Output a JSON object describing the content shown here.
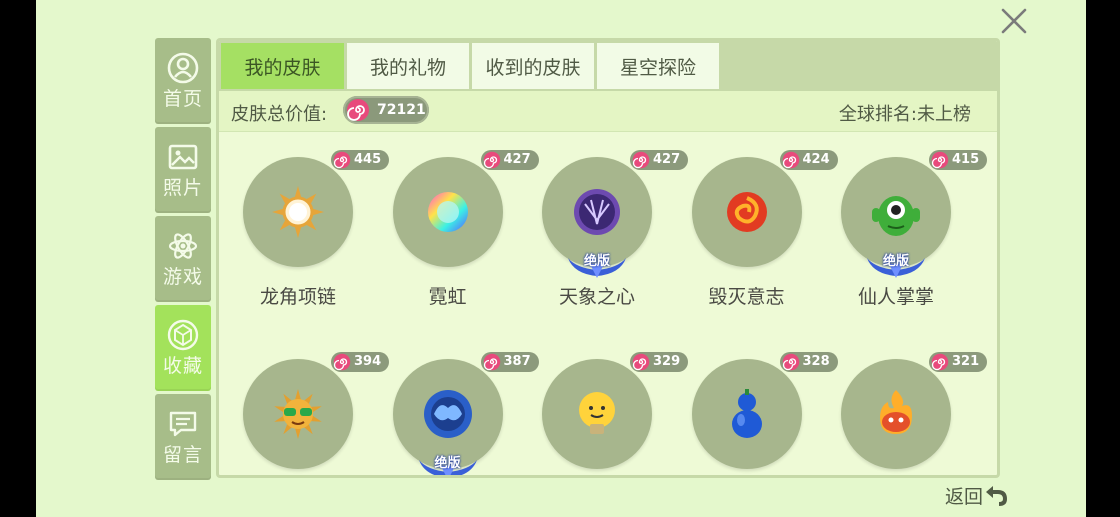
{
  "nav": [
    {
      "label": "首页",
      "icon": "profile-icon"
    },
    {
      "label": "照片",
      "icon": "photo-icon"
    },
    {
      "label": "游戏",
      "icon": "atom-icon"
    },
    {
      "label": "收藏",
      "icon": "diamond-icon",
      "active": true
    },
    {
      "label": "留言",
      "icon": "message-icon"
    }
  ],
  "tabs": [
    {
      "label": "我的皮肤",
      "active": true
    },
    {
      "label": "我的礼物"
    },
    {
      "label": "收到的皮肤"
    },
    {
      "label": "星空探险"
    }
  ],
  "value": {
    "label": "皮肤总价值:",
    "amount": "72121"
  },
  "rank": {
    "label": "全球排名:",
    "value": "未上榜"
  },
  "items": [
    {
      "name": "龙角项链",
      "price": "445",
      "icon": "sun-icon",
      "limited": false
    },
    {
      "name": "霓虹",
      "price": "427",
      "icon": "neon-orb-icon",
      "limited": false
    },
    {
      "name": "天象之心",
      "price": "427",
      "icon": "purple-orb-icon",
      "limited": true
    },
    {
      "name": "毁灭意志",
      "price": "424",
      "icon": "fire-swirl-icon",
      "limited": false
    },
    {
      "name": "仙人掌掌",
      "price": "415",
      "icon": "cactus-monster-icon",
      "limited": true
    },
    {
      "name": "",
      "price": "394",
      "icon": "sunglasses-sun-icon",
      "limited": false
    },
    {
      "name": "",
      "price": "387",
      "icon": "blue-dragon-icon",
      "limited": true
    },
    {
      "name": "",
      "price": "329",
      "icon": "light-bulb-icon",
      "limited": false
    },
    {
      "name": "",
      "price": "328",
      "icon": "gourd-icon",
      "limited": false
    },
    {
      "name": "",
      "price": "321",
      "icon": "flame-face-icon",
      "limited": false
    }
  ],
  "limited_label": "绝版",
  "back_label": "返回",
  "colors": {
    "screen_bg": "#e4f8cc",
    "nav": "#a7bd89",
    "nav_active": "#a3e25b",
    "tab_active": "#a5e063",
    "circle": "#a7b68d",
    "candy": "#e84a7c"
  }
}
